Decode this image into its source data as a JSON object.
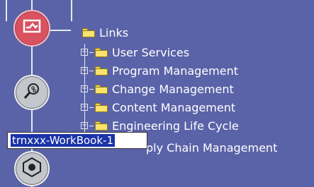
{
  "tree": {
    "root_label": "Links",
    "items": [
      {
        "label": "User Services"
      },
      {
        "label": "Program Management"
      },
      {
        "label": "Change Management"
      },
      {
        "label": "Content Management"
      },
      {
        "label": "Engineering Life Cycle"
      }
    ],
    "partial_item_label": "ply Chain Management"
  },
  "rename_box": {
    "value": "trnxxx-WorkBook-1"
  },
  "icons": {
    "top": "chart-monitor-icon",
    "middle": "magnifier-link-icon",
    "bottom": "globe-network-icon"
  },
  "colors": {
    "background": "#5a63a8",
    "accent_red": "#d9525f",
    "selection": "#1a33a8"
  }
}
